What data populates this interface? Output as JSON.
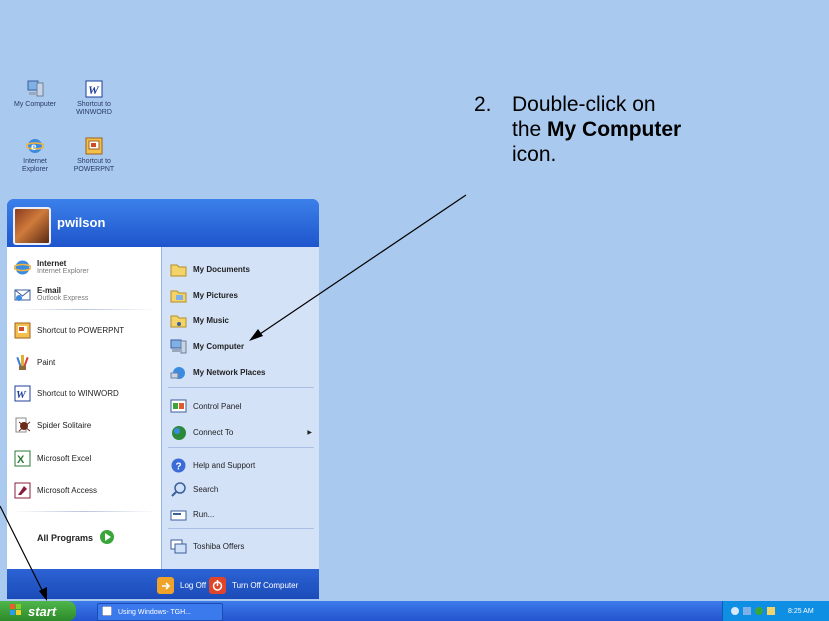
{
  "instruction": {
    "number": "2.",
    "text_pre": "Double-click on",
    "text_the": "the ",
    "bold": "My Computer",
    "text_post": "icon."
  },
  "desktop": {
    "my_computer": {
      "line1": "My Computer",
      "line2": ""
    },
    "winword": {
      "line1": "Shortcut to",
      "line2": "WINWORD"
    },
    "ie": {
      "line1": "Internet",
      "line2": "Explorer"
    },
    "powerpnt": {
      "line1": "Shortcut to",
      "line2": "POWERPNT"
    }
  },
  "start_menu": {
    "user": "pwilson",
    "left": [
      {
        "label": "Internet",
        "sub": "Internet Explorer",
        "icon": "ie-icon"
      },
      {
        "label": "E-mail",
        "sub": "Outlook Express",
        "icon": "email-icon"
      },
      {
        "label": "Shortcut to POWERPNT",
        "icon": "powerpoint-icon"
      },
      {
        "label": "Paint",
        "icon": "paint-icon"
      },
      {
        "label": "Shortcut to WINWORD",
        "icon": "word-icon"
      },
      {
        "label": "Spider Solitaire",
        "icon": "spider-icon"
      },
      {
        "label": "Microsoft Excel",
        "icon": "excel-icon"
      },
      {
        "label": "Microsoft Access",
        "icon": "access-icon"
      }
    ],
    "all_programs": "All Programs",
    "right": [
      {
        "label": "My Documents",
        "icon": "folder-icon"
      },
      {
        "label": "My Pictures",
        "icon": "folder-pictures-icon"
      },
      {
        "label": "My Music",
        "icon": "folder-music-icon"
      },
      {
        "label": "My Computer",
        "icon": "computer-icon"
      },
      {
        "label": "My Network Places",
        "icon": "network-icon"
      },
      {
        "label": "Control Panel",
        "icon": "control-panel-icon"
      },
      {
        "label": "Connect To",
        "icon": "connect-icon"
      },
      {
        "label": "Help and Support",
        "icon": "help-icon"
      },
      {
        "label": "Search",
        "icon": "search-icon"
      },
      {
        "label": "Run...",
        "icon": "run-icon"
      },
      {
        "label": "Toshiba Offers",
        "icon": "toshiba-icon"
      }
    ],
    "log_off": "Log Off",
    "turn_off": "Turn Off Computer"
  },
  "taskbar": {
    "start": "start",
    "task": "Using Windows- TGH...",
    "clock": "8:25 AM"
  },
  "colors": {
    "desktop": "#a9c9ee",
    "accent": "#2f62d7",
    "start_green": "#3ca338"
  }
}
